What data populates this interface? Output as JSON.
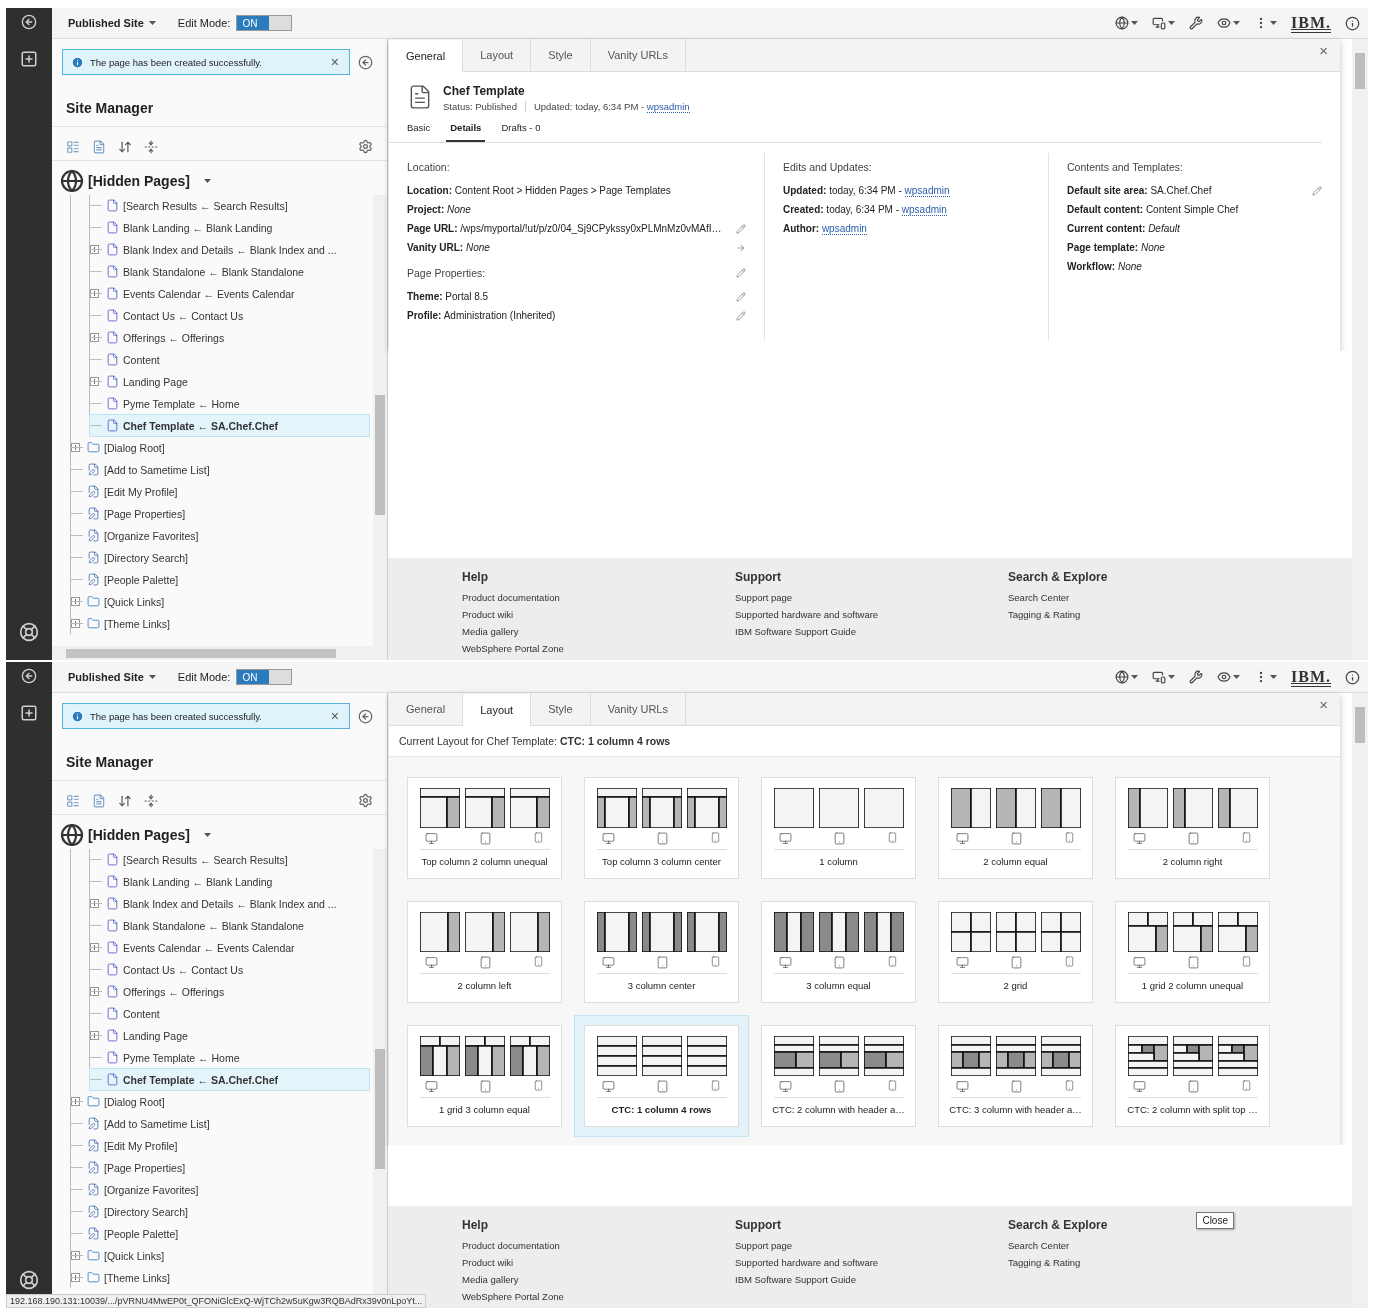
{
  "screens": [
    {
      "toolbar": {
        "site_menu": "Published Site",
        "edit_mode_label": "Edit Mode:",
        "edit_mode": {
          "label": "ON",
          "on": true
        },
        "logo": "IBM."
      },
      "notification": {
        "text": "The page has been created successfully.",
        "close": "×"
      },
      "site_manager": {
        "title": "Site Manager",
        "root": "[Hidden Pages]",
        "tree": [
          {
            "children": [
              {
                "label": "[Search Results ← Search Results]",
                "kind": "page",
                "expandable": false,
                "selected": false
              },
              {
                "label": "Blank Landing ← Blank Landing",
                "kind": "page",
                "expandable": false,
                "selected": false
              },
              {
                "label": "Blank Index and Details ← Blank Index and ...",
                "kind": "page",
                "expandable": true,
                "selected": false
              },
              {
                "label": "Blank Standalone ← Blank Standalone",
                "kind": "page",
                "expandable": false,
                "selected": false
              },
              {
                "label": "Events Calendar ← Events Calendar",
                "kind": "page",
                "expandable": true,
                "selected": false
              },
              {
                "label": "Contact Us ← Contact Us",
                "kind": "page",
                "expandable": false,
                "selected": false
              },
              {
                "label": "Offerings ← Offerings",
                "kind": "page",
                "expandable": true,
                "selected": false
              },
              {
                "label": "Content",
                "kind": "page",
                "expandable": false,
                "selected": false
              },
              {
                "label": "Landing Page",
                "kind": "page",
                "expandable": true,
                "selected": false
              },
              {
                "label": "Pyme Template ← Home",
                "kind": "page",
                "expandable": false,
                "selected": false
              },
              {
                "label": "Chef Template ← SA.Chef.Chef",
                "kind": "page",
                "expandable": false,
                "selected": true
              }
            ]
          },
          {
            "label": "[Dialog Root]",
            "kind": "folder",
            "expandable": true,
            "selected": false
          },
          {
            "label": "[Add to Sametime List]",
            "kind": "portlet",
            "expandable": false,
            "selected": false
          },
          {
            "label": "[Edit My Profile]",
            "kind": "portlet",
            "expandable": false,
            "selected": false
          },
          {
            "label": "[Page Properties]",
            "kind": "portlet",
            "expandable": false,
            "selected": false
          },
          {
            "label": "[Organize Favorites]",
            "kind": "portlet",
            "expandable": false,
            "selected": false
          },
          {
            "label": "[Directory Search]",
            "kind": "portlet",
            "expandable": false,
            "selected": false
          },
          {
            "label": "[People Palette]",
            "kind": "portlet",
            "expandable": false,
            "selected": false
          },
          {
            "label": "[Quick Links]",
            "kind": "folder",
            "expandable": true,
            "selected": false
          },
          {
            "label": "[Theme Links]",
            "kind": "folder",
            "expandable": true,
            "selected": false
          }
        ]
      },
      "panel": {
        "kind": "details",
        "close": "×",
        "tabs": [
          {
            "label": "General",
            "selected": true
          },
          {
            "label": "Layout",
            "selected": false
          },
          {
            "label": "Style",
            "selected": false
          },
          {
            "label": "Vanity URLs",
            "selected": false
          }
        ],
        "page": {
          "title": "Chef Template",
          "status": "Status: Published",
          "updated": "Updated: today, 6:34 PM -",
          "updated_by": "wpsadmin"
        },
        "subtabs": [
          {
            "label": "Basic",
            "selected": false
          },
          {
            "label": "Details",
            "selected": true
          },
          {
            "label": "Drafts - 0",
            "selected": false
          }
        ],
        "sections": [
          {
            "groups": [
              {
                "heading": "Location:",
                "fields": [
                  {
                    "label": "Location:",
                    "value": "Content Root  >  Hidden Pages  >  Page Templates",
                    "italic": false
                  },
                  {
                    "label": "Project:",
                    "value": "None",
                    "italic": true
                  },
                  {
                    "label": "Page URL:",
                    "value": "/wps/myportal/!ut/p/z0/04_Sj9CPykssy0xPLMnMz0vMAfI…",
                    "italic": false,
                    "editable": true
                  },
                  {
                    "label": "Vanity URL:",
                    "value": "None",
                    "italic": true,
                    "has_arrow": true
                  }
                ]
              },
              {
                "heading": "Page Properties:",
                "editable": true,
                "fields": [
                  {
                    "label": "Theme:",
                    "value": "Portal 8.5",
                    "italic": false,
                    "editable": true
                  },
                  {
                    "label": "Profile:",
                    "value": "Administration (Inherited)",
                    "italic": false,
                    "editable": true
                  }
                ]
              }
            ]
          },
          {
            "groups": [
              {
                "heading": "Edits and Updates:",
                "fields": [
                  {
                    "label": "Updated:",
                    "value": "today, 6:34 PM -",
                    "link": "wpsadmin",
                    "italic": false
                  },
                  {
                    "label": "Created:",
                    "value": "today, 6:34 PM -",
                    "link": "wpsadmin",
                    "italic": false
                  },
                  {
                    "label": "Author:",
                    "link": "wpsadmin"
                  }
                ]
              }
            ]
          },
          {
            "groups": [
              {
                "heading": "Contents and Templates:",
                "fields": [
                  {
                    "label": "Default site area:",
                    "value": "SA.Chef.Chef",
                    "italic": false,
                    "editable": true
                  },
                  {
                    "label": "Default content:",
                    "value": "Content Simple Chef",
                    "italic": false
                  },
                  {
                    "label": "Current content:",
                    "value": "Default",
                    "italic": true
                  },
                  {
                    "label": "Page template:",
                    "value": "None",
                    "italic": true
                  },
                  {
                    "label": "Workflow:",
                    "value": "None",
                    "italic": true
                  }
                ]
              }
            ]
          }
        ]
      },
      "footer": {
        "columns": [
          {
            "heading": "Help",
            "links": [
              "Product documentation",
              "Product wiki",
              "Media gallery",
              "WebSphere Portal Zone"
            ]
          },
          {
            "heading": "Support",
            "links": [
              "Support page",
              "Supported hardware and software",
              "IBM Software Support Guide"
            ]
          },
          {
            "heading": "Search & Explore",
            "links": [
              "Search Center",
              "Tagging & Rating"
            ]
          }
        ]
      }
    },
    {
      "toolbar": {
        "site_menu": "Published Site",
        "edit_mode_label": "Edit Mode:",
        "edit_mode": {
          "label": "ON",
          "on": true
        },
        "logo": "IBM."
      },
      "notification": {
        "text": "The page has been created successfully.",
        "close": "×"
      },
      "site_manager": {
        "title": "Site Manager",
        "root": "[Hidden Pages]",
        "tree": [
          {
            "children": [
              {
                "label": "[Search Results ← Search Results]",
                "kind": "page",
                "expandable": false,
                "selected": false
              },
              {
                "label": "Blank Landing ← Blank Landing",
                "kind": "page",
                "expandable": false,
                "selected": false
              },
              {
                "label": "Blank Index and Details ← Blank Index and ...",
                "kind": "page",
                "expandable": true,
                "selected": false
              },
              {
                "label": "Blank Standalone ← Blank Standalone",
                "kind": "page",
                "expandable": false,
                "selected": false
              },
              {
                "label": "Events Calendar ← Events Calendar",
                "kind": "page",
                "expandable": true,
                "selected": false
              },
              {
                "label": "Contact Us ← Contact Us",
                "kind": "page",
                "expandable": false,
                "selected": false
              },
              {
                "label": "Offerings ← Offerings",
                "kind": "page",
                "expandable": true,
                "selected": false
              },
              {
                "label": "Content",
                "kind": "page",
                "expandable": false,
                "selected": false
              },
              {
                "label": "Landing Page",
                "kind": "page",
                "expandable": true,
                "selected": false
              },
              {
                "label": "Pyme Template ← Home",
                "kind": "page",
                "expandable": false,
                "selected": false
              },
              {
                "label": "Chef Template ← SA.Chef.Chef",
                "kind": "page",
                "expandable": false,
                "selected": true
              }
            ]
          },
          {
            "label": "[Dialog Root]",
            "kind": "folder",
            "expandable": true,
            "selected": false
          },
          {
            "label": "[Add to Sametime List]",
            "kind": "portlet",
            "expandable": false,
            "selected": false
          },
          {
            "label": "[Edit My Profile]",
            "kind": "portlet",
            "expandable": false,
            "selected": false
          },
          {
            "label": "[Page Properties]",
            "kind": "portlet",
            "expandable": false,
            "selected": false
          },
          {
            "label": "[Organize Favorites]",
            "kind": "portlet",
            "expandable": false,
            "selected": false
          },
          {
            "label": "[Directory Search]",
            "kind": "portlet",
            "expandable": false,
            "selected": false
          },
          {
            "label": "[People Palette]",
            "kind": "portlet",
            "expandable": false,
            "selected": false
          },
          {
            "label": "[Quick Links]",
            "kind": "folder",
            "expandable": true,
            "selected": false
          },
          {
            "label": "[Theme Links]",
            "kind": "folder",
            "expandable": true,
            "selected": false
          }
        ]
      },
      "panel": {
        "kind": "layout",
        "close": "×",
        "tabs": [
          {
            "label": "General",
            "selected": false
          },
          {
            "label": "Layout",
            "selected": true
          },
          {
            "label": "Style",
            "selected": false
          },
          {
            "label": "Vanity URLs",
            "selected": false
          }
        ],
        "current_label": "Current Layout for Chef Template:",
        "current_value": "CTC: 1 column 4 rows",
        "layouts": [
          {
            "name": "Top column 2 column unequal",
            "selected": false
          },
          {
            "name": "Top column 3 column center",
            "selected": false
          },
          {
            "name": "1 column",
            "selected": false
          },
          {
            "name": "2 column equal",
            "selected": false
          },
          {
            "name": "2 column right",
            "selected": false
          },
          {
            "name": "2 column left",
            "selected": false
          },
          {
            "name": "3 column center",
            "selected": false
          },
          {
            "name": "3 column equal",
            "selected": false
          },
          {
            "name": "2 grid",
            "selected": false
          },
          {
            "name": "1 grid 2 column unequal",
            "selected": false
          },
          {
            "name": "1 grid 3 column equal",
            "selected": false
          },
          {
            "name": "CTC: 1 column 4 rows",
            "selected": true
          },
          {
            "name": "CTC: 2 column with header a…",
            "selected": false
          },
          {
            "name": "CTC: 3 column with header a…",
            "selected": false
          },
          {
            "name": "CTC: 2 column with split top …",
            "selected": false
          }
        ]
      },
      "footer": {
        "tooltip": "Close",
        "columns": [
          {
            "heading": "Help",
            "links": [
              "Product documentation",
              "Product wiki",
              "Media gallery",
              "WebSphere Portal Zone"
            ]
          },
          {
            "heading": "Support",
            "links": [
              "Support page",
              "Supported hardware and software",
              "IBM Software Support Guide"
            ]
          },
          {
            "heading": "Search & Explore",
            "links": [
              "Search Center",
              "Tagging & Rating"
            ]
          }
        ]
      }
    }
  ],
  "status_bar": {
    "url": "192.168.190.131:10039/.../pVRNU4MwEP0t_QFONiGlcExQ-WjTCh2w5uKgw3RQBAdRx39v0nLpoYt..."
  }
}
